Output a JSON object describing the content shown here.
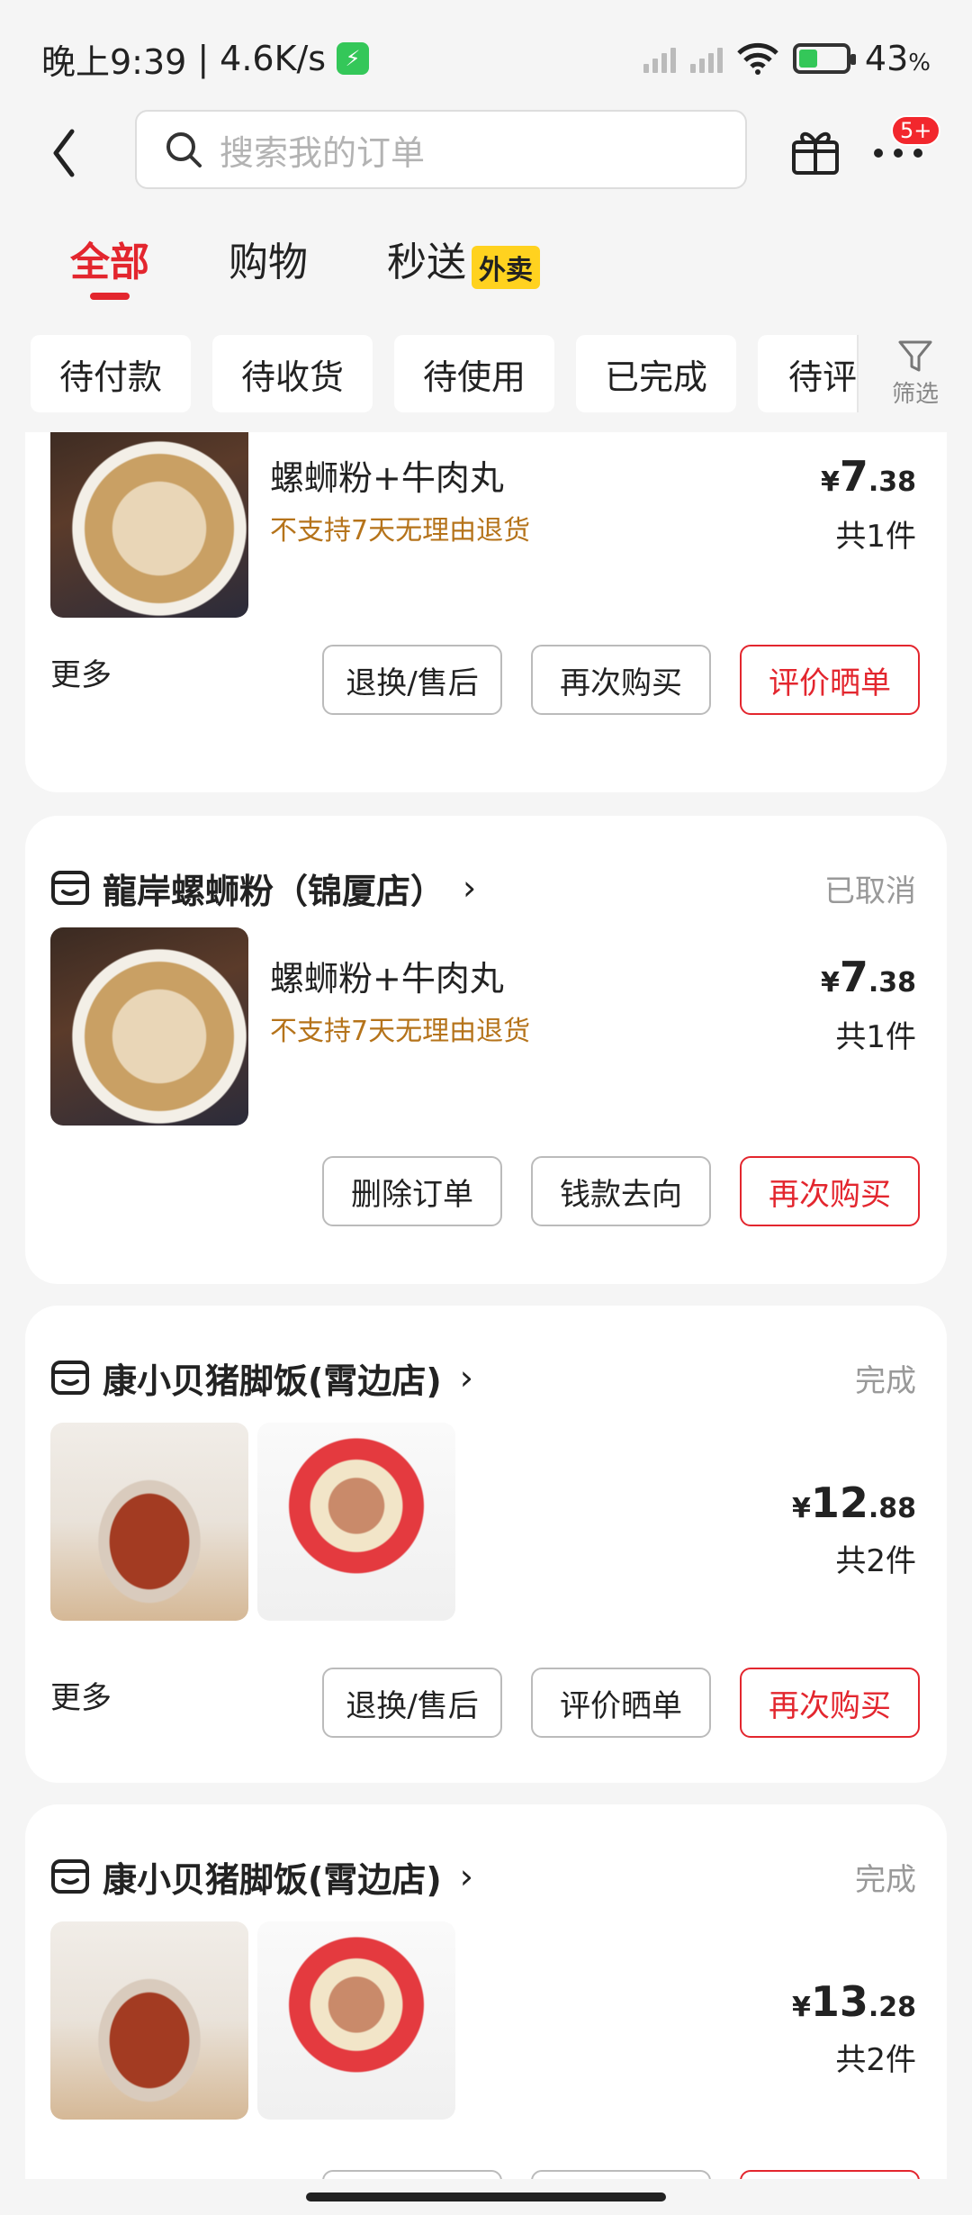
{
  "status_bar": {
    "time": "晚上9:39",
    "network_speed": "4.6K/s",
    "battery_percent": "43",
    "battery_unit": "%"
  },
  "nav": {
    "search_placeholder": "搜索我的订单",
    "badge": "5+"
  },
  "tabs": [
    {
      "label": "全部",
      "active": true
    },
    {
      "label": "购物",
      "active": false
    },
    {
      "label": "秒送",
      "active": false,
      "tag": "外卖"
    }
  ],
  "filter_chips": [
    "待付款",
    "待收货",
    "待使用",
    "已完成",
    "待评价"
  ],
  "filter_label": "筛选",
  "orders": [
    {
      "shop": "",
      "status": "",
      "item_name": "螺蛳粉+牛肉丸",
      "note": "不支持7天无理由退货",
      "price_currency": "¥",
      "price_int": "7",
      "price_dec": ".38",
      "qty": "共1件",
      "more": "更多",
      "buttons": [
        "退换/售后",
        "再次购买",
        "评价晒单"
      ]
    },
    {
      "shop": "龍岸螺蛳粉（锦厦店）",
      "status": "已取消",
      "item_name": "螺蛳粉+牛肉丸",
      "note": "不支持7天无理由退货",
      "price_currency": "¥",
      "price_int": "7",
      "price_dec": ".38",
      "qty": "共1件",
      "buttons": [
        "删除订单",
        "钱款去向",
        "再次购买"
      ]
    },
    {
      "shop": "康小贝猪脚饭(霄边店)",
      "status": "完成",
      "price_currency": "¥",
      "price_int": "12",
      "price_dec": ".88",
      "qty": "共2件",
      "more": "更多",
      "buttons": [
        "退换/售后",
        "评价晒单",
        "再次购买"
      ]
    },
    {
      "shop": "康小贝猪脚饭(霄边店)",
      "status": "完成",
      "price_currency": "¥",
      "price_int": "13",
      "price_dec": ".28",
      "qty": "共2件"
    }
  ],
  "colors": {
    "accent": "#e3262e",
    "note": "#b5731a",
    "tag": "#ffd21f"
  }
}
